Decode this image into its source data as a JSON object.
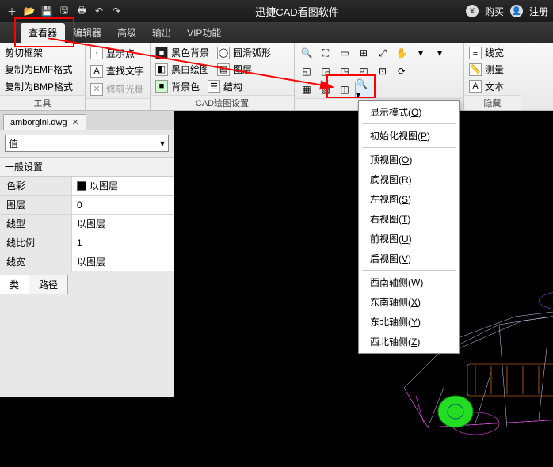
{
  "titlebar": {
    "title": "迅捷CAD看图软件",
    "buy": "购买",
    "register": "注册"
  },
  "menubar": {
    "tabs": [
      "查看器",
      "编辑器",
      "高级",
      "输出",
      "VIP功能"
    ],
    "active": 0
  },
  "ribbon": {
    "group1": {
      "items": [
        "剪切框架",
        "复制为EMF格式",
        "复制为BMP格式"
      ],
      "label": "工具"
    },
    "group2": {
      "items": [
        "显示点",
        "查找文字",
        "修剪光栅"
      ]
    },
    "group3": {
      "col1": [
        "黑色背景",
        "黑白绘图",
        "背景色"
      ],
      "col2": [
        "圆滑弧形",
        "图层",
        "结构"
      ],
      "label": "CAD绘图设置"
    },
    "group4": {
      "items": [
        "线宽",
        "测量",
        "文本"
      ],
      "label": "隐藏"
    }
  },
  "document": {
    "filename": "amborgini.dwg"
  },
  "properties": {
    "selector": "值",
    "section": "一般设置",
    "rows": [
      {
        "k": "色彩",
        "v": "以图层",
        "swatch": true
      },
      {
        "k": "图层",
        "v": "0"
      },
      {
        "k": "线型",
        "v": "以图层"
      },
      {
        "k": "线比例",
        "v": "1"
      },
      {
        "k": "线宽",
        "v": "以图层"
      }
    ],
    "tabs": [
      "类",
      "路径"
    ]
  },
  "dropdown": {
    "items": [
      {
        "label": "显示模式",
        "key": "O"
      },
      {
        "sep": true
      },
      {
        "label": "初始化视图",
        "key": "P"
      },
      {
        "sep": true
      },
      {
        "label": "顶视图",
        "key": "O"
      },
      {
        "label": "底视图",
        "key": "R"
      },
      {
        "label": "左视图",
        "key": "S"
      },
      {
        "label": "右视图",
        "key": "T"
      },
      {
        "label": "前视图",
        "key": "U"
      },
      {
        "label": "后视图",
        "key": "V"
      },
      {
        "sep": true
      },
      {
        "label": "西南轴侧",
        "key": "W"
      },
      {
        "label": "东南轴侧",
        "key": "X"
      },
      {
        "label": "东北轴侧",
        "key": "Y"
      },
      {
        "label": "西北轴侧",
        "key": "Z"
      }
    ]
  }
}
